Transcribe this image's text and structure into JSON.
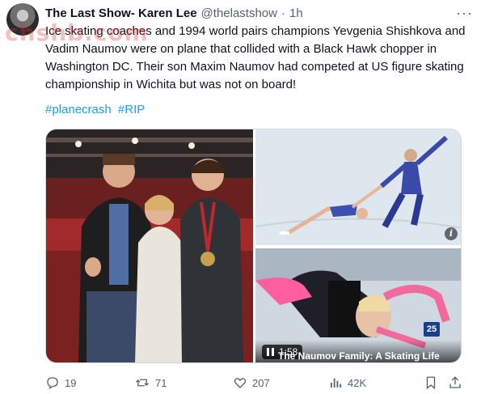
{
  "tweet": {
    "author_name": "The Last Show- Karen Lee",
    "handle": "@thelastshow",
    "separator": "·",
    "time": "1h",
    "more_label": "···",
    "text": "Ice skating coaches and 1994 world pairs champions Yevgenia Shishkova and Vadim Naumov were on plane that collided with a Black Hawk chopper in Washington DC. Their son Maxim Naumov had competed at US figure skating championship in Wichita but was not on board!",
    "hashtags": [
      "#planecrash",
      "#RIP"
    ]
  },
  "watermark": "chshb.com",
  "media": {
    "info_label": "i",
    "video": {
      "time": "1:58",
      "caption": "The Naumov Family: A Skating Life",
      "channel": "25"
    }
  },
  "actions": {
    "replies": "19",
    "reposts": "71",
    "likes": "207",
    "views": "42K"
  },
  "colors": {
    "link": "#1d9bf0",
    "muted": "#536471",
    "text": "#0f1419"
  },
  "icons": [
    "more-icon",
    "info-icon",
    "pause-icon",
    "reply-icon",
    "repost-icon",
    "like-icon",
    "views-icon",
    "bookmark-icon",
    "share-icon"
  ]
}
